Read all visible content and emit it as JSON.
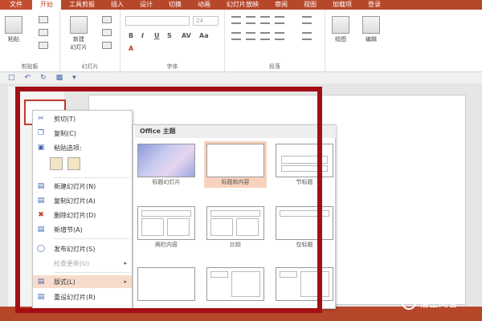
{
  "tabs": [
    {
      "label": "文件"
    },
    {
      "label": "开始"
    },
    {
      "label": "工具剪报"
    },
    {
      "label": "插入"
    },
    {
      "label": "设计"
    },
    {
      "label": "切换"
    },
    {
      "label": "动画"
    },
    {
      "label": "幻灯片放映"
    },
    {
      "label": "审阅"
    },
    {
      "label": "视图"
    },
    {
      "label": "加载项"
    },
    {
      "label": "登录"
    }
  ],
  "ribbon": {
    "clipboard": {
      "paste_label": "粘贴",
      "group_label": "剪贴板"
    },
    "slides": {
      "new_slide_label": "新建\n幻灯片",
      "group_label": "幻灯片"
    },
    "font": {
      "font_size": "24",
      "group_label": "字体",
      "bold": "B",
      "italic": "I",
      "underline": "U",
      "strike": "S",
      "spacing": "AV",
      "case": "Aa",
      "font_color": "A"
    },
    "paragraph": {
      "group_label": "段落"
    },
    "drawing": {
      "label": "绘图"
    },
    "editing": {
      "label": "编辑"
    }
  },
  "context_menu": {
    "items": [
      {
        "label": "剪切(T)",
        "icon": "scissors-icon"
      },
      {
        "label": "复制(C)",
        "icon": "copy-icon"
      },
      {
        "label": "粘贴选项:",
        "icon": "paste-icon"
      },
      {
        "label": "新建幻灯片(N)",
        "icon": "new-slide-icon"
      },
      {
        "label": "复制幻灯片(A)",
        "icon": "duplicate-slide-icon"
      },
      {
        "label": "删除幻灯片(D)",
        "icon": "delete-slide-icon"
      },
      {
        "label": "新增节(A)",
        "icon": "add-section-icon"
      },
      {
        "label": "发布幻灯片(S)",
        "icon": "publish-icon"
      },
      {
        "label": "检查更新(U)",
        "icon": "",
        "disabled": true
      },
      {
        "label": "版式(L)",
        "icon": "layout-icon",
        "highlighted": true
      },
      {
        "label": "重设幻灯片(R)",
        "icon": "reset-icon"
      }
    ]
  },
  "layout_submenu": {
    "title": "Office 主题",
    "layouts": [
      {
        "label": "标题幻灯片"
      },
      {
        "label": "标题和内容",
        "selected": true
      },
      {
        "label": "节标题"
      },
      {
        "label": "两栏内容"
      },
      {
        "label": "比较"
      },
      {
        "label": "仅标题"
      },
      {
        "label": ""
      },
      {
        "label": ""
      },
      {
        "label": ""
      }
    ]
  },
  "watermark": {
    "text": "悟空问答"
  },
  "colors": {
    "accent": "#b7472a",
    "annotation": "#a30f14",
    "hover": "#f8d2bd"
  }
}
